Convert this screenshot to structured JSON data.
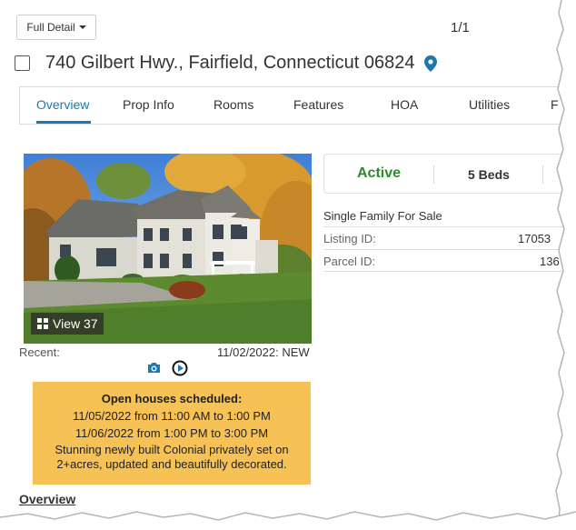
{
  "toolbar": {
    "detail_label": "Full Detail",
    "page_count": "1/1"
  },
  "listing": {
    "address": "740 Gilbert Hwy., Fairfield, Connecticut 06824",
    "status": "Active",
    "beds": "5 Beds",
    "property_type": "Single Family For Sale",
    "listing_id_label": "Listing ID:",
    "listing_id_value": "17053",
    "parcel_id_label": "Parcel ID:",
    "parcel_id_value": "136"
  },
  "tabs": [
    {
      "label": "Overview",
      "active": true
    },
    {
      "label": "Prop Info"
    },
    {
      "label": "Rooms"
    },
    {
      "label": "Features"
    },
    {
      "label": "HOA"
    },
    {
      "label": "Utilities"
    },
    {
      "label": "F"
    }
  ],
  "photo": {
    "view_label": "View 37"
  },
  "recent": {
    "label": "Recent:",
    "value": "11/02/2022: NEW"
  },
  "open_house": {
    "title": "Open houses scheduled:",
    "line1": "11/05/2022 from 11:00 AM to 1:00 PM",
    "line2": "11/06/2022 from 1:00 PM to 3:00 PM",
    "description": "Stunning newly built Colonial privately set on 2+acres, updated and beautifully decorated."
  },
  "section": {
    "overview_heading": "Overview"
  },
  "icons": {
    "caret": "chevron-down-icon",
    "pin": "map-pin-icon",
    "grid": "grid-icon",
    "camera": "camera-icon",
    "play": "play-circle-icon"
  },
  "colors": {
    "accent": "#1c79b0",
    "active_status": "#2c8a2c",
    "open_house_bg": "#f6c155"
  }
}
